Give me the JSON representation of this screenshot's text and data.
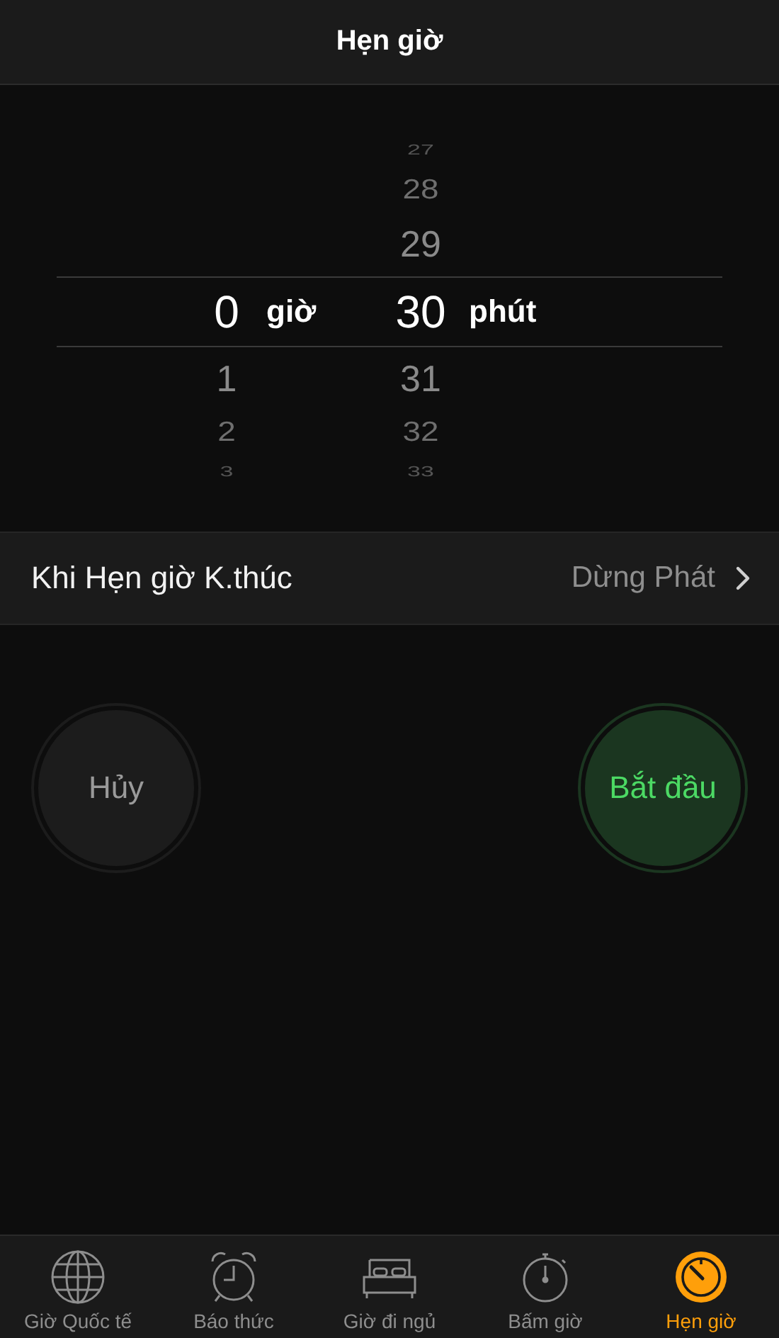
{
  "nav_bar": {
    "title": "Hẹn giờ"
  },
  "picker": {
    "hour_unit": "giờ",
    "minute_unit": "phút",
    "hours": [
      {
        "value": "0",
        "selected": true
      },
      {
        "value": "1",
        "selected": false
      },
      {
        "value": "2",
        "selected": false
      },
      {
        "value": "3",
        "selected": false
      }
    ],
    "minutes": [
      {
        "value": "27",
        "selected": false
      },
      {
        "value": "28",
        "selected": false
      },
      {
        "value": "29",
        "selected": false
      },
      {
        "value": "30",
        "selected": true
      },
      {
        "value": "31",
        "selected": false
      },
      {
        "value": "32",
        "selected": false
      },
      {
        "value": "33",
        "selected": false
      }
    ]
  },
  "setting_row": {
    "label": "Khi Hẹn giờ K.thúc",
    "value": "Dừng Phát"
  },
  "buttons": [
    {
      "label": "Hủy",
      "kind": "cancel"
    },
    {
      "label": "Bắt đầu",
      "kind": "start"
    }
  ],
  "tab_bar": [
    {
      "label": "Giờ Quốc tế",
      "selected": false
    },
    {
      "label": "Báo thức",
      "selected": false
    },
    {
      "label": "Giờ đi ngủ",
      "selected": false
    },
    {
      "label": "Bấm giờ",
      "selected": false
    },
    {
      "label": "Hẹn giờ",
      "selected": true
    }
  ]
}
